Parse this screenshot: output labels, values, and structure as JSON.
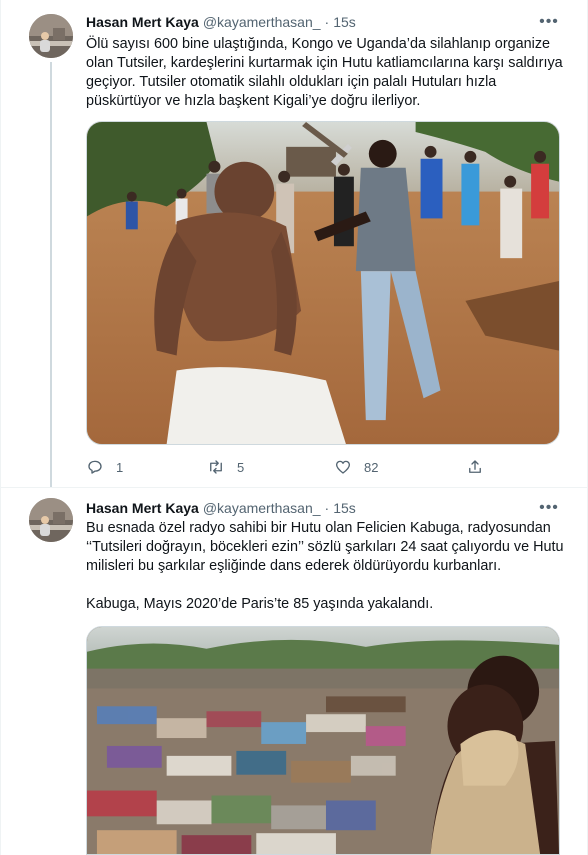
{
  "tweets": [
    {
      "author": "Hasan Mert Kaya",
      "handle": "@kayamerthasan_",
      "time": "15s",
      "paragraphs": [
        "Ölü sayısı 600 bine ulaştığında, Kongo ve Uganda’da silahlanıp organize olan Tutsiler, kardeşlerini kurtarmak için Hutu katliamcılarına karşı saldırıya geçiyor. Tutsiler otomatik silahlı oldukları için palalı Hutuları hızla püskürtüyor ve hızla başkent Kigali’ye doğru ilerliyor."
      ],
      "replies": "1",
      "retweets": "5",
      "likes": "82"
    },
    {
      "author": "Hasan Mert Kaya",
      "handle": "@kayamerthasan_",
      "time": "15s",
      "paragraphs": [
        "Bu esnada özel radyo sahibi bir Hutu olan Felicien Kabuga, radyosundan ‘‘Tutsileri doğrayın, böcekleri ezin’’ sözlü şarkıları 24 saat çalıyordu ve Hutu milisleri bu şarkılar eşliğinde dans ederek öldürüyordu kurbanları.",
        "Kabuga, Mayıs 2020’de Paris’te 85 yaşında yakalandı."
      ]
    }
  ],
  "separator": "·",
  "icons": {
    "more": "more-horizontal-icon",
    "reply": "reply-icon",
    "retweet": "retweet-icon",
    "like": "heart-icon",
    "share": "share-icon"
  },
  "colors": {
    "text": "#0f1419",
    "secondary": "#536471",
    "border": "#eff3f4",
    "thread_line": "#cfd9de"
  }
}
